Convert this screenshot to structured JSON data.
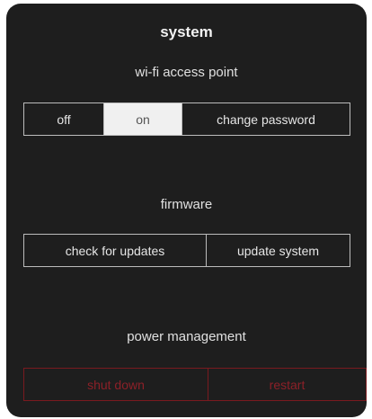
{
  "panel": {
    "title": "system"
  },
  "wifi": {
    "label": "wi-fi access point",
    "options": [
      "off",
      "on",
      "change password"
    ],
    "selected": "on"
  },
  "firmware": {
    "label": "firmware",
    "options": [
      "check for updates",
      "update system"
    ]
  },
  "power": {
    "label": "power management",
    "options": [
      "shut down",
      "restart"
    ]
  },
  "colors": {
    "panel_background": "#1e1e1e",
    "selected_background": "#f0f0f0",
    "danger": "#8c2028"
  }
}
